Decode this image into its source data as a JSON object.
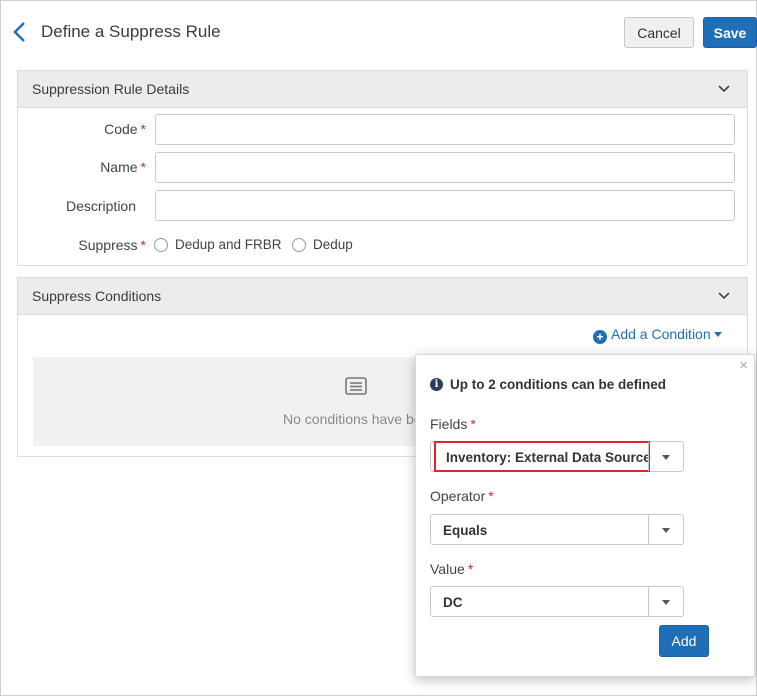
{
  "header": {
    "title": "Define a Suppress Rule",
    "cancel_label": "Cancel",
    "save_label": "Save"
  },
  "details": {
    "title": "Suppression Rule Details",
    "code_label": "Code",
    "name_label": "Name",
    "description_label": "Description",
    "suppress_label": "Suppress",
    "required_mark": "*",
    "options": [
      "Dedup and FRBR",
      "Dedup"
    ]
  },
  "conditions": {
    "title": "Suppress Conditions",
    "add_label": "Add a Condition",
    "empty_text": "No conditions have be"
  },
  "popover": {
    "info": "Up to 2 conditions can be defined",
    "fields_label": "Fields",
    "fields_value": "Inventory: External Data Source",
    "operator_label": "Operator",
    "operator_value": "Equals",
    "value_label": "Value",
    "value_value": "DC",
    "add_label": "Add",
    "close": "×",
    "info_icon": "i"
  },
  "colors": {
    "accent": "#1f6fb8",
    "required": "#d8272a",
    "highlight": "#e0262b"
  },
  "icons": {
    "back": "chevron-left-icon",
    "collapse": "chevron-down-icon",
    "add": "plus-circle-icon",
    "info": "info-icon",
    "empty": "list-icon"
  }
}
